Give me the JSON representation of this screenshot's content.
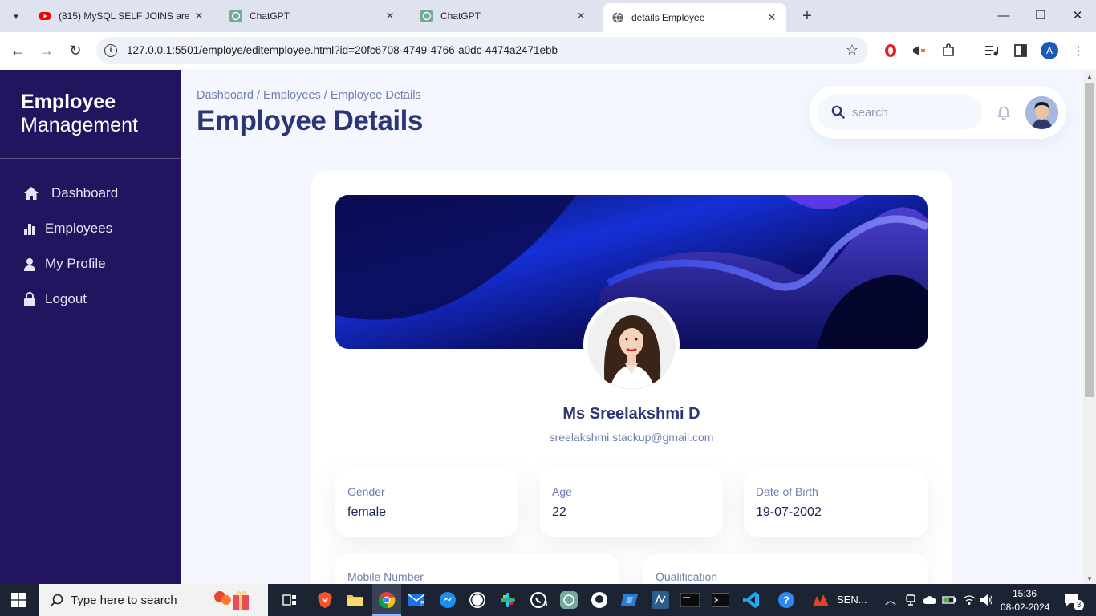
{
  "browser": {
    "tabs": [
      {
        "title": "(815) MySQL SELF JOINS are ...",
        "icon": "youtube-icon"
      },
      {
        "title": "ChatGPT",
        "icon": "chatgpt-icon"
      },
      {
        "title": "ChatGPT",
        "icon": "chatgpt-icon"
      },
      {
        "title": "details Employee",
        "icon": "globe-icon",
        "active": true
      }
    ],
    "url": "127.0.0.1:5501/employe/editemployee.html?id=20fc6708-4749-4766-a0dc-4474a2471ebb",
    "profile_initial": "A"
  },
  "sidebar": {
    "brand_line1": "Employee",
    "brand_line2": "Management",
    "items": [
      {
        "label": "Dashboard",
        "icon": "home-icon"
      },
      {
        "label": "Employees",
        "icon": "bar-chart-icon"
      },
      {
        "label": "My Profile",
        "icon": "user-icon"
      },
      {
        "label": "Logout",
        "icon": "lock-icon"
      }
    ]
  },
  "header": {
    "breadcrumb": "Dashboard / Employees / Employee Details",
    "title": "Employee Details",
    "search_placeholder": "search"
  },
  "profile": {
    "name": "Ms Sreelakshmi D",
    "email": "sreelakshmi.stackup@gmail.com",
    "fields": [
      {
        "label": "Gender",
        "value": "female"
      },
      {
        "label": "Age",
        "value": "22"
      },
      {
        "label": "Date of Birth",
        "value": "19-07-2002"
      },
      {
        "label": "Mobile Number",
        "value": ""
      },
      {
        "label": "Qualification",
        "value": ""
      }
    ]
  },
  "taskbar": {
    "search_placeholder": "Type here to search",
    "badge_mail": "5",
    "badge_whatsapp": "3",
    "sen_label": "SEN...",
    "time": "15:36",
    "date": "08-02-2024",
    "notification_count": "3"
  },
  "colors": {
    "sidebar_bg": "#22145e",
    "title_color": "#2b3674",
    "page_bg": "#f4f7fe"
  }
}
